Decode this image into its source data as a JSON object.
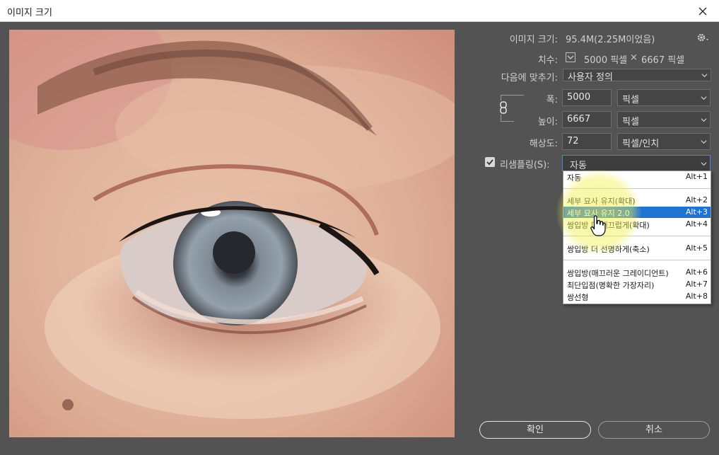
{
  "window": {
    "title": "이미지 크기"
  },
  "info": {
    "image_size_label": "이미지 크기:",
    "image_size_value": "95.4M(2.25M이었음)",
    "dimensions_label": "치수:",
    "dimensions_w": "5000 픽셀",
    "dimensions_x": "×",
    "dimensions_h": "6667 픽셀"
  },
  "fit_to": {
    "label": "다음에 맞추기:",
    "value": "사용자 정의"
  },
  "width": {
    "label": "폭:",
    "value": "5000",
    "unit": "픽셀"
  },
  "height": {
    "label": "높이:",
    "value": "6667",
    "unit": "픽셀"
  },
  "resolution": {
    "label": "해상도:",
    "value": "72",
    "unit": "픽셀/인치"
  },
  "resample": {
    "label": "리샘플링(S):",
    "checked": true,
    "value": "자동",
    "options": [
      {
        "label": "자동",
        "shortcut": "Alt+1"
      },
      {
        "label": "세부 묘사 유지(확대)",
        "shortcut": "Alt+2"
      },
      {
        "label": "세부 묘사 유지 2.0",
        "shortcut": "Alt+3"
      },
      {
        "label": "쌍입방 더 매끄럽게(확대)",
        "shortcut": "Alt+4"
      },
      {
        "label": "쌍입방 더 선명하게(축소)",
        "shortcut": "Alt+5"
      },
      {
        "label": "쌍입방(매끄러운 그레이디언트)",
        "shortcut": "Alt+6"
      },
      {
        "label": "최단입점(명확한 가장자리)",
        "shortcut": "Alt+7"
      },
      {
        "label": "쌍선형",
        "shortcut": "Alt+8"
      }
    ],
    "selected_index": 2
  },
  "buttons": {
    "ok": "확인",
    "cancel": "취소"
  },
  "icons": {
    "close": "close-icon",
    "gear": "gear-icon",
    "chain": "chain-link-icon",
    "chevron": "chevron-down-icon",
    "cursor": "hand-pointer-icon"
  },
  "colors": {
    "accent": "#1e74d0",
    "panel": "#535353",
    "field": "#454545"
  }
}
